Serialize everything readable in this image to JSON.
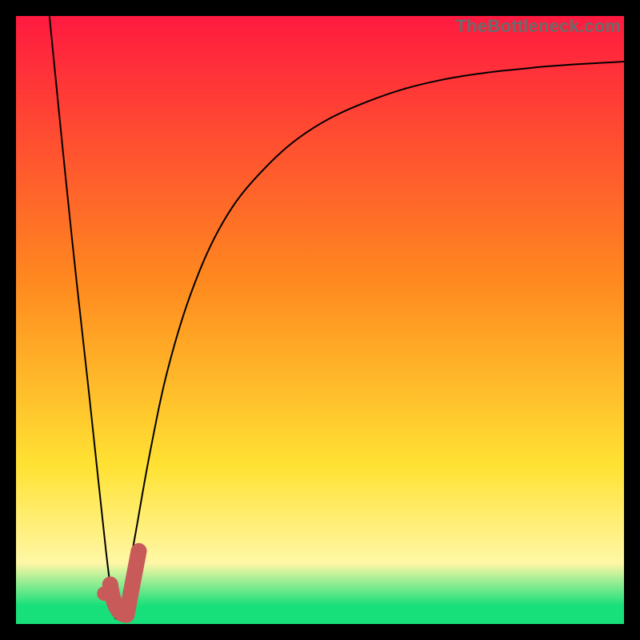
{
  "watermark": "TheBottleneck.com",
  "colors": {
    "red": "#ff1a40",
    "orange": "#ff8a1f",
    "yellow": "#ffe233",
    "lightyellow": "#fff7a6",
    "green": "#17e07a",
    "curve": "#000000",
    "marker": "#c85a5a",
    "frame_bg": "#000000"
  },
  "chart_data": {
    "type": "line",
    "title": "",
    "xlabel": "",
    "ylabel": "",
    "xlim": [
      0,
      100
    ],
    "ylim": [
      0,
      100
    ],
    "note": "y is a mismatch/bottleneck percentage; minimum (~0) occurs near x≈16 where the marker sits",
    "curve_points": [
      {
        "x": 5.5,
        "y": 100
      },
      {
        "x": 8,
        "y": 75
      },
      {
        "x": 10,
        "y": 56
      },
      {
        "x": 12,
        "y": 38
      },
      {
        "x": 13.5,
        "y": 24
      },
      {
        "x": 14.8,
        "y": 12
      },
      {
        "x": 15.8,
        "y": 4
      },
      {
        "x": 16.3,
        "y": 1
      },
      {
        "x": 17,
        "y": 2
      },
      {
        "x": 18,
        "y": 6
      },
      {
        "x": 19.5,
        "y": 14
      },
      {
        "x": 22,
        "y": 28
      },
      {
        "x": 25,
        "y": 42
      },
      {
        "x": 29,
        "y": 55
      },
      {
        "x": 34,
        "y": 66
      },
      {
        "x": 40,
        "y": 74
      },
      {
        "x": 48,
        "y": 81
      },
      {
        "x": 58,
        "y": 86
      },
      {
        "x": 70,
        "y": 89.5
      },
      {
        "x": 85,
        "y": 91.5
      },
      {
        "x": 100,
        "y": 92.5
      }
    ],
    "marker": {
      "dot": {
        "x": 14.5,
        "y": 5
      },
      "hook": [
        {
          "x": 15.5,
          "y": 6.5
        },
        {
          "x": 16.2,
          "y": 1.5
        },
        {
          "x": 18.2,
          "y": 1.5
        },
        {
          "x": 20.2,
          "y": 12
        }
      ]
    },
    "gradient_stops": [
      {
        "pct": 0,
        "color_key": "red"
      },
      {
        "pct": 44,
        "color_key": "orange"
      },
      {
        "pct": 74,
        "color_key": "yellow"
      },
      {
        "pct": 90,
        "color_key": "lightyellow"
      },
      {
        "pct": 97,
        "color_key": "green"
      },
      {
        "pct": 100,
        "color_key": "green"
      }
    ]
  }
}
